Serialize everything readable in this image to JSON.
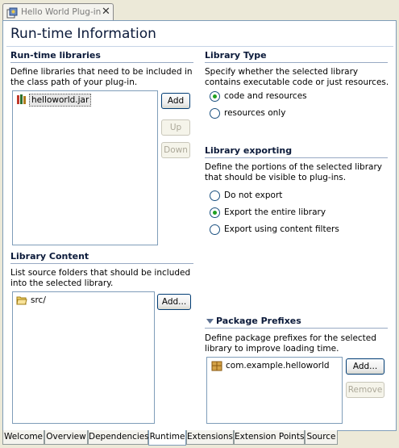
{
  "editor_tab": {
    "title": "Hello World Plug-in",
    "close": "✕"
  },
  "page_title": "Run-time Information",
  "runtime_libraries": {
    "title": "Run-time libraries",
    "description": "Define libraries that need to be included in the class path of your plug-in.",
    "items": [
      {
        "label": "helloworld.jar",
        "icon": "jar-icon",
        "selected": true
      }
    ],
    "buttons": {
      "add": "Add",
      "up": "Up",
      "down": "Down"
    }
  },
  "library_type": {
    "title": "Library Type",
    "description": "Specify whether the selected library contains executable code or just resources.",
    "options": [
      {
        "label": "code and resources",
        "checked": true
      },
      {
        "label": "resources only",
        "checked": false
      }
    ]
  },
  "library_exporting": {
    "title": "Library exporting",
    "description": "Define the portions of the selected library that should be visible to plug-ins.",
    "options": [
      {
        "label": "Do not export",
        "checked": false
      },
      {
        "label": "Export the entire library",
        "checked": true
      },
      {
        "label": "Export using content filters",
        "checked": false
      }
    ]
  },
  "library_content": {
    "title": "Library Content",
    "description": "List source folders that should be included into the selected library.",
    "items": [
      {
        "label": "src/",
        "icon": "folder-icon"
      }
    ],
    "buttons": {
      "add": "Add..."
    }
  },
  "package_prefixes": {
    "title": "Package Prefixes",
    "description": "Define package prefixes for the selected library to improve loading time.",
    "items": [
      {
        "label": "com.example.helloworld",
        "icon": "package-icon"
      }
    ],
    "buttons": {
      "add": "Add...",
      "remove": "Remove"
    }
  },
  "bottom_tabs": [
    {
      "label": "Welcome",
      "active": false
    },
    {
      "label": "Overview",
      "active": false
    },
    {
      "label": "Dependencies",
      "active": false
    },
    {
      "label": "Runtime",
      "active": true
    },
    {
      "label": "Extensions",
      "active": false
    },
    {
      "label": "Extension Points",
      "active": false
    },
    {
      "label": "Source",
      "active": false
    }
  ],
  "colors": {
    "title_text": "#0b1a3a",
    "section_rule": "#98aac4",
    "radio_dot": "#21a121",
    "selection": "#e6e6e6"
  }
}
